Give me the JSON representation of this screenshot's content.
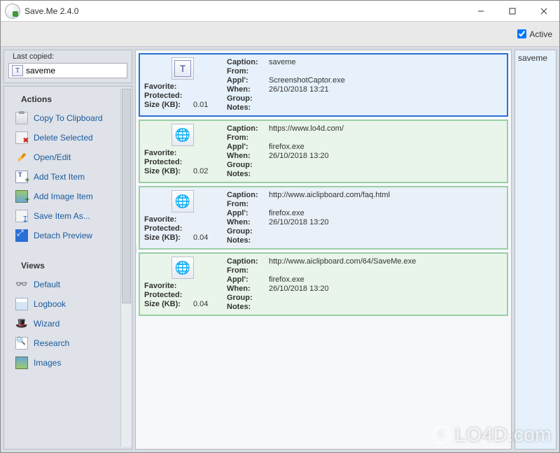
{
  "window": {
    "title": "Save.Me 2.4.0"
  },
  "toolbar": {
    "active_label": "Active",
    "active_checked": true
  },
  "sidebar": {
    "last_copied_label": "Last copied:",
    "last_copied_value": "saveme",
    "sections": {
      "actions_label": "Actions",
      "views_label": "Views"
    },
    "actions": [
      {
        "label": "Copy To Clipboard",
        "icon": "clipboard-icon"
      },
      {
        "label": "Delete Selected",
        "icon": "delete-icon"
      },
      {
        "label": "Open/Edit",
        "icon": "pencil-icon"
      },
      {
        "label": "Add Text Item",
        "icon": "add-text-icon"
      },
      {
        "label": "Add Image Item",
        "icon": "add-image-icon"
      },
      {
        "label": "Save Item As...",
        "icon": "save-as-icon"
      },
      {
        "label": "Detach Preview",
        "icon": "detach-icon"
      }
    ],
    "views": [
      {
        "label": "Default",
        "icon": "glasses-icon"
      },
      {
        "label": "Logbook",
        "icon": "logbook-icon"
      },
      {
        "label": "Wizard",
        "icon": "wizard-icon"
      },
      {
        "label": "Research",
        "icon": "research-icon"
      },
      {
        "label": "Images",
        "icon": "images-icon"
      }
    ]
  },
  "field_labels": {
    "favorite": "Favorite:",
    "protected": "Protected:",
    "size": "Size (KB):",
    "caption": "Caption:",
    "from": "From:",
    "appl": "Appl':",
    "when": "When:",
    "group": "Group:",
    "notes": "Notes:"
  },
  "items": [
    {
      "selected": true,
      "thumb": "text",
      "favorite": "",
      "protected": "",
      "size": "0.01",
      "caption": "saveme",
      "from": "",
      "appl": "ScreenshotCaptor.exe",
      "when": "26/10/2018 13:21",
      "group": "",
      "notes": ""
    },
    {
      "selected": false,
      "thumb": "globe",
      "favorite": "",
      "protected": "",
      "size": "0.02",
      "caption": "https://www.lo4d.com/",
      "from": "",
      "appl": "firefox.exe",
      "when": "26/10/2018 13:20",
      "group": "",
      "notes": ""
    },
    {
      "selected": false,
      "thumb": "globe",
      "favorite": "",
      "protected": "",
      "size": "0.04",
      "caption": "http://www.aiclipboard.com/faq.html",
      "from": "",
      "appl": "firefox.exe",
      "when": "26/10/2018 13:20",
      "group": "",
      "notes": ""
    },
    {
      "selected": false,
      "thumb": "globe",
      "favorite": "",
      "protected": "",
      "size": "0.04",
      "caption": "http://www.aiclipboard.com/64/SaveMe.exe",
      "from": "",
      "appl": "firefox.exe",
      "when": "26/10/2018 13:20",
      "group": "",
      "notes": ""
    }
  ],
  "preview": {
    "text": "saveme"
  },
  "watermark": "LO4D.com"
}
